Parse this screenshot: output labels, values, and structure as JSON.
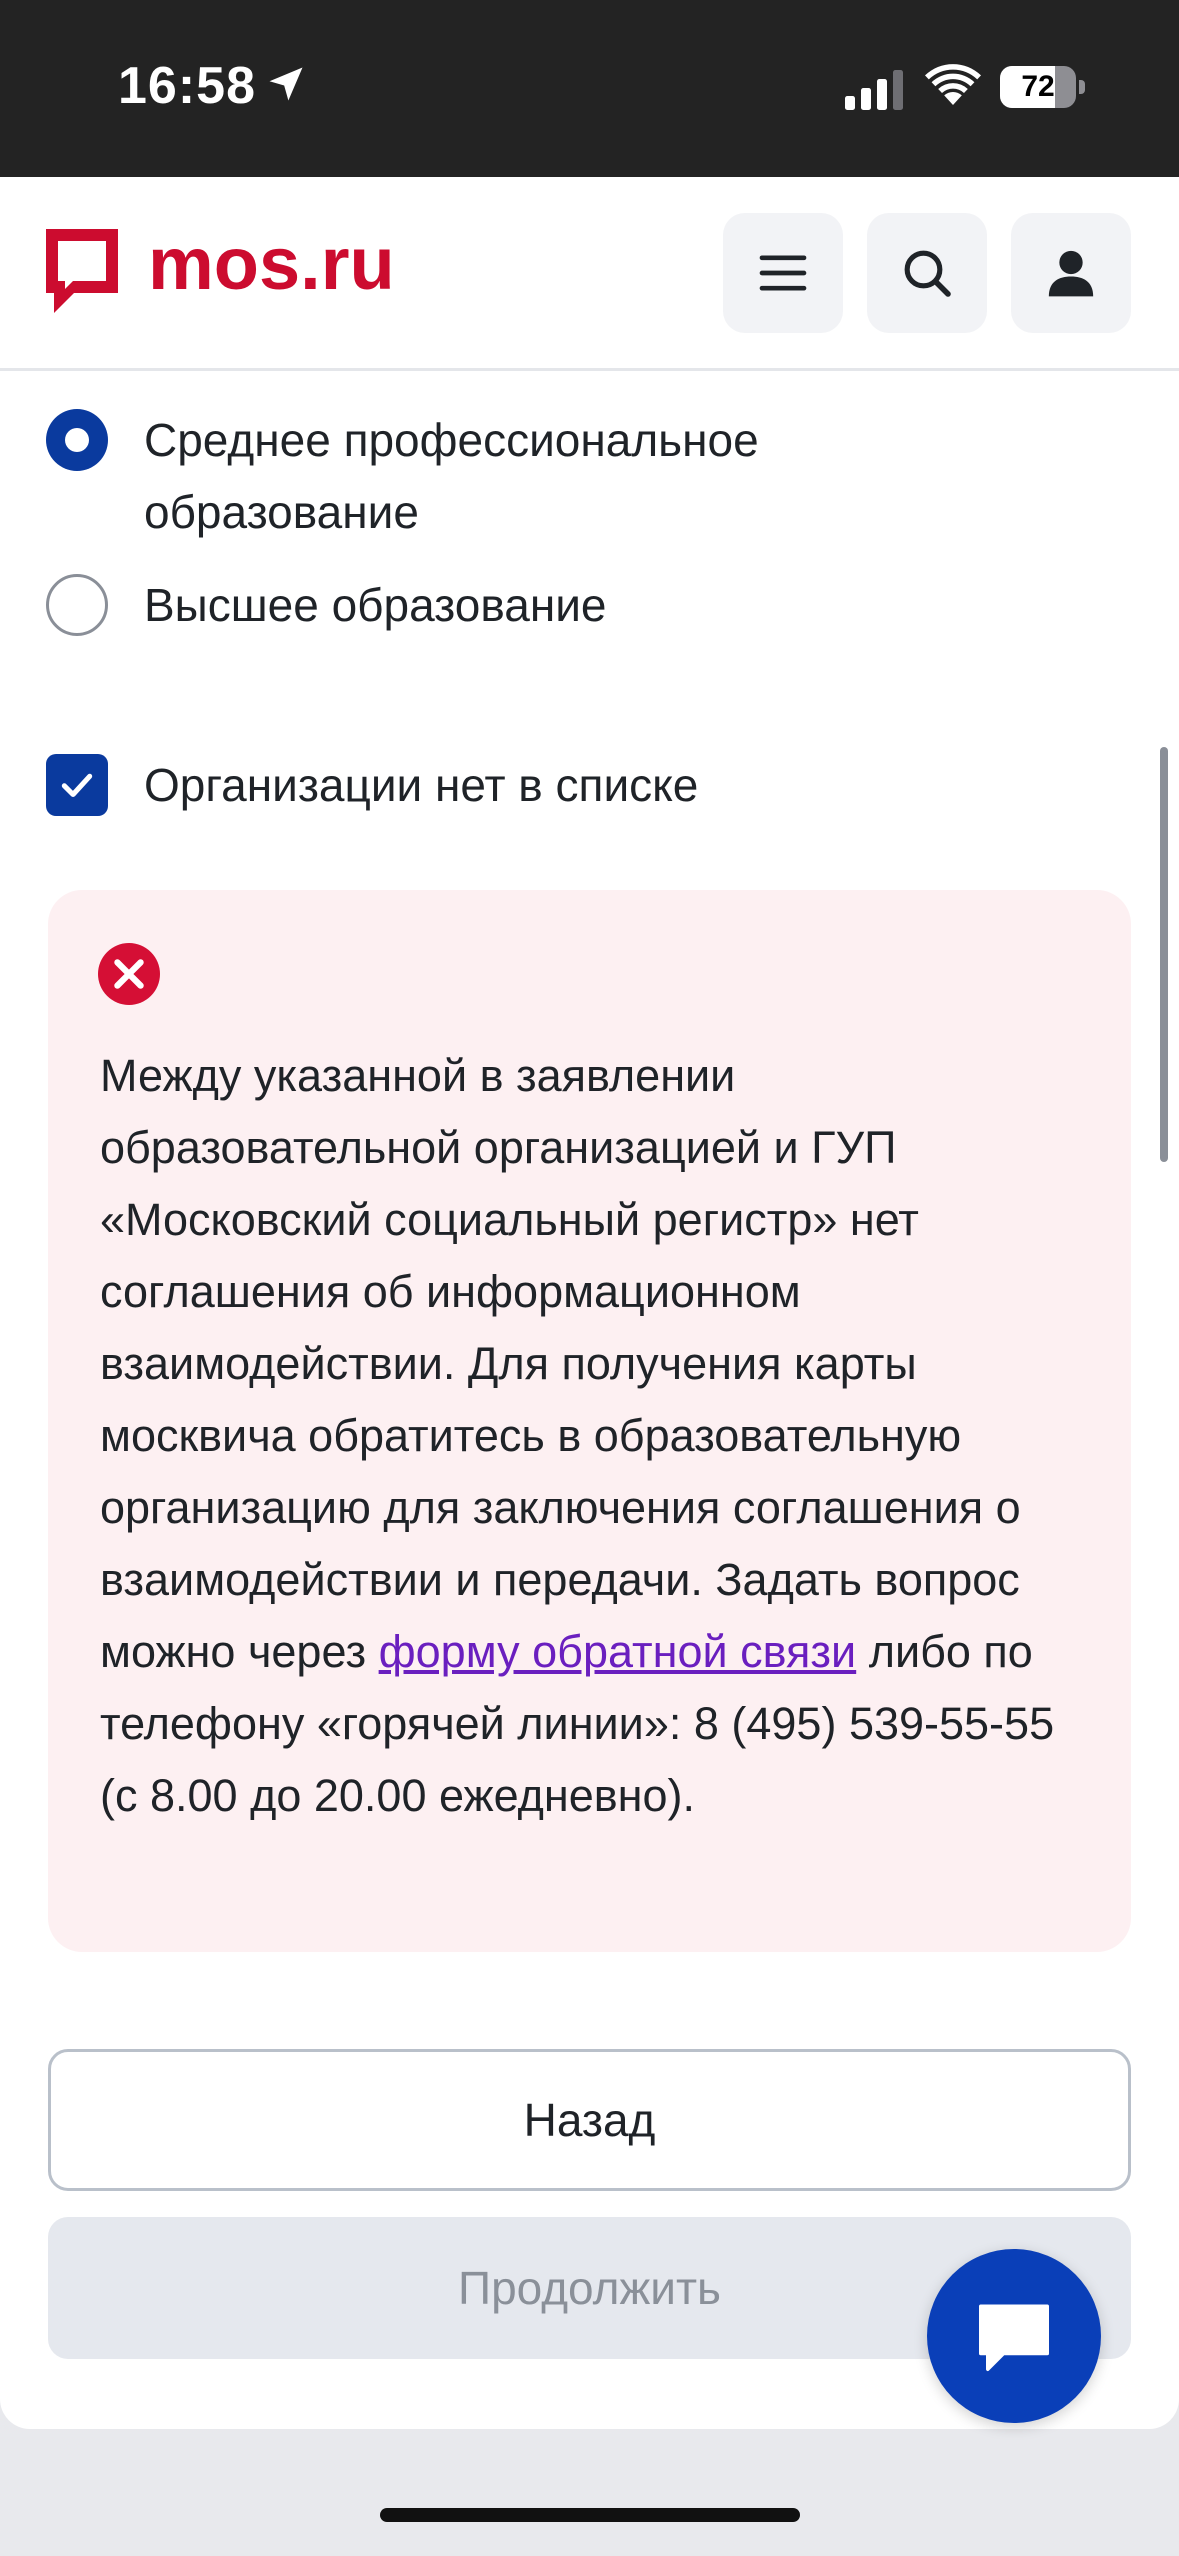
{
  "status_bar": {
    "time": "16:58",
    "battery_level": "72",
    "battery_fraction": 0.72,
    "icons": [
      "location-arrow-icon",
      "cellular-signal-icon",
      "wifi-icon",
      "battery-icon"
    ]
  },
  "header": {
    "logo_text": "mos.ru",
    "brand_color": "#cc0c2f",
    "icons": [
      "menu-icon",
      "search-icon",
      "profile-icon"
    ]
  },
  "education_options": [
    {
      "label": "Среднее профессиональное образование",
      "selected": true
    },
    {
      "label": "Высшее образование",
      "selected": false
    }
  ],
  "checkbox": {
    "label": "Организации нет в списке",
    "checked": true
  },
  "error": {
    "icon": "error-x-icon",
    "text_before_link": "Между указанной в заявлении образовательной организацией и ГУП «Московский социальный регистр» нет соглашения об информационном взаимодействии. Для получения карты москвича обратитесь в образовательную организацию для заключения соглашения о взаимодействии и передачи. Задать вопрос можно через ",
    "link_text": "форму обратной связи",
    "text_after_link": " либо по телефону «горячей линии»: 8 (495) 539-55-55 (с 8.00 до 20.00 ежедневно).",
    "background": "#fdf0f2",
    "accent": "#d50f35"
  },
  "buttons": {
    "back_label": "Назад",
    "continue_label": "Продолжить"
  },
  "chat": {
    "icon": "chat-bubble-icon",
    "color": "#0a3fb8"
  },
  "accent_color": "#0a3a9e"
}
